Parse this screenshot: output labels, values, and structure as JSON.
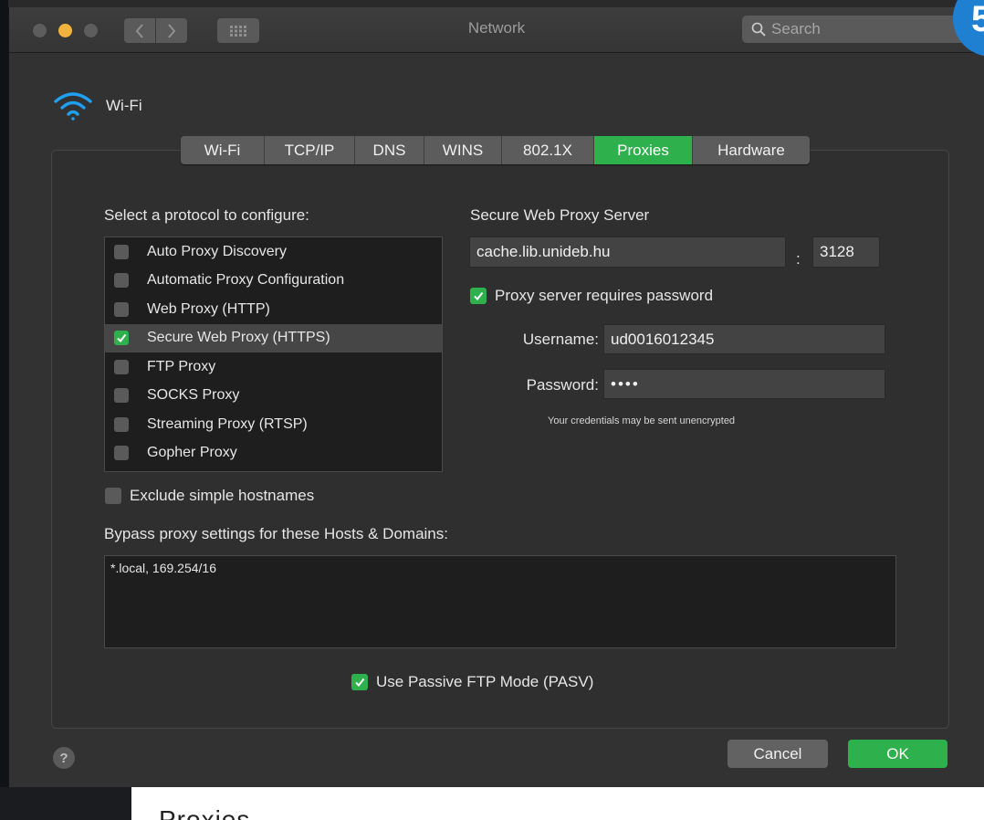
{
  "window": {
    "title": "Network",
    "search_placeholder": "Search",
    "badge": "5"
  },
  "interface": {
    "name": "Wi-Fi"
  },
  "tabs": [
    {
      "label": "Wi-Fi",
      "active": false
    },
    {
      "label": "TCP/IP",
      "active": false
    },
    {
      "label": "DNS",
      "active": false
    },
    {
      "label": "WINS",
      "active": false
    },
    {
      "label": "802.1X",
      "active": false
    },
    {
      "label": "Proxies",
      "active": true
    },
    {
      "label": "Hardware",
      "active": false
    }
  ],
  "protocols": {
    "heading": "Select a protocol to configure:",
    "items": [
      {
        "label": "Auto Proxy Discovery",
        "checked": false
      },
      {
        "label": "Automatic Proxy Configuration",
        "checked": false
      },
      {
        "label": "Web Proxy (HTTP)",
        "checked": false
      },
      {
        "label": "Secure Web Proxy (HTTPS)",
        "checked": true
      },
      {
        "label": "FTP Proxy",
        "checked": false
      },
      {
        "label": "SOCKS Proxy",
        "checked": false
      },
      {
        "label": "Streaming Proxy (RTSP)",
        "checked": false
      },
      {
        "label": "Gopher Proxy",
        "checked": false
      }
    ]
  },
  "proxy_server": {
    "heading": "Secure Web Proxy Server",
    "host": "cache.lib.unideb.hu",
    "separator": ":",
    "port": "3128",
    "requires_password_label": "Proxy server requires password",
    "requires_password": true,
    "username_label": "Username:",
    "username": "ud0016012345",
    "password_label": "Password:",
    "password": "••••",
    "note": "Your credentials may be sent unencrypted"
  },
  "exclude_simple_hostnames": {
    "label": "Exclude simple hostnames",
    "checked": false
  },
  "bypass": {
    "heading": "Bypass proxy settings for these Hosts & Domains:",
    "value": "*.local, 169.254/16"
  },
  "passive_ftp": {
    "label": "Use Passive FTP Mode (PASV)",
    "checked": true
  },
  "buttons": {
    "help": "?",
    "cancel": "Cancel",
    "ok": "OK"
  },
  "footer_caption": "Proxies",
  "colors": {
    "accent": "#2eb14c",
    "window": "#323232",
    "titlebar": "#3a3a3a"
  }
}
